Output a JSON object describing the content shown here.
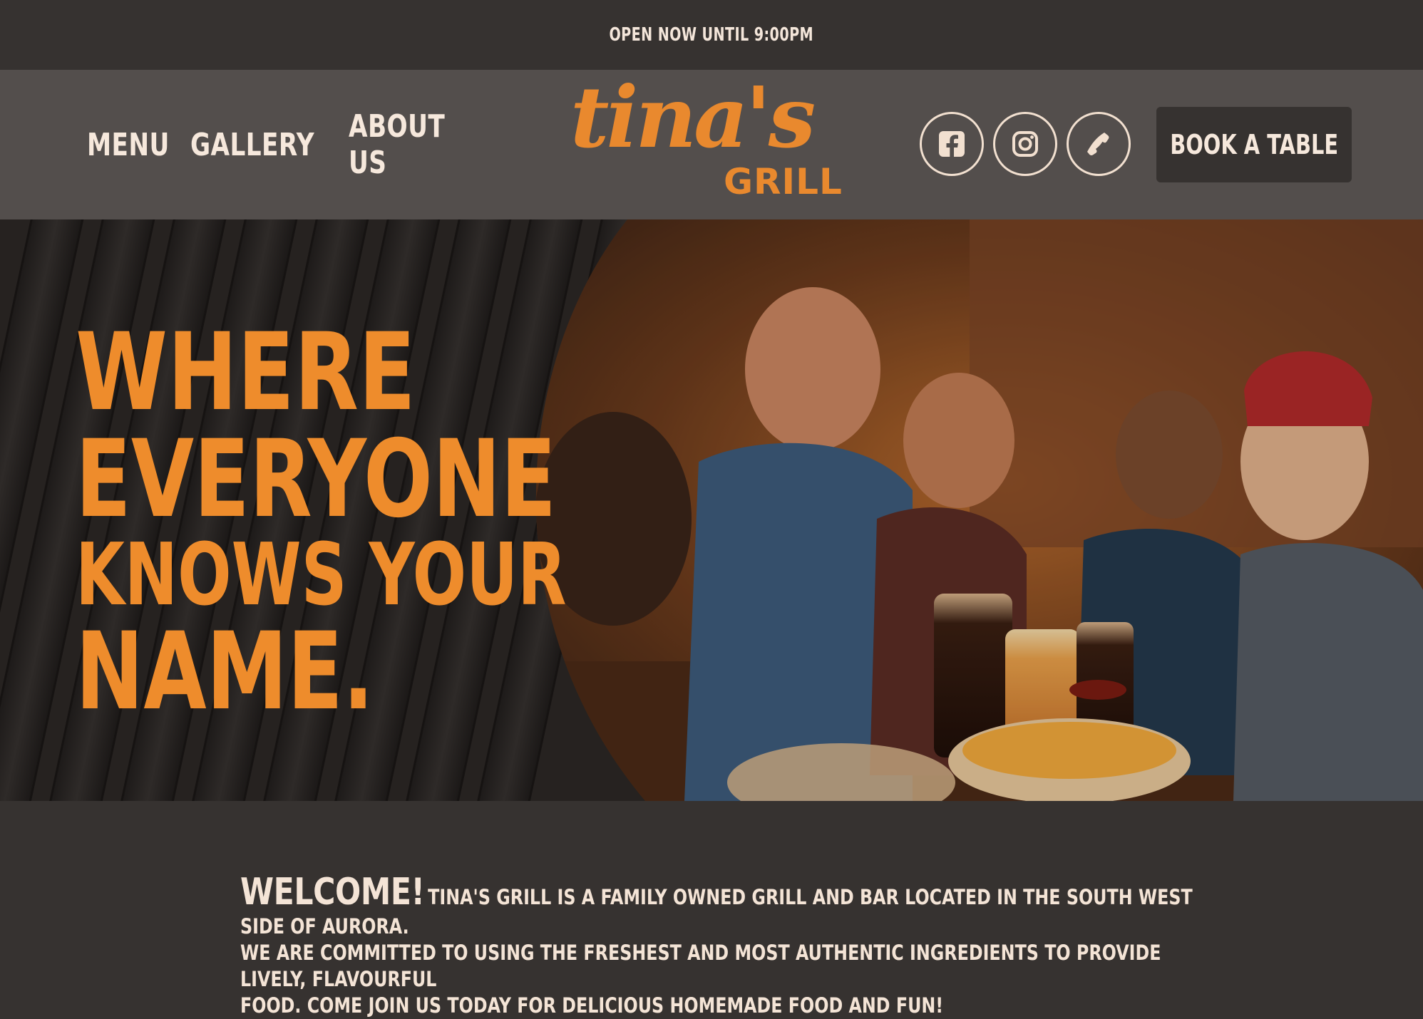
{
  "announcement": "OPEN NOW UNTIL 9:00PM",
  "nav": {
    "items": [
      "MENU",
      "GALLERY",
      "ABOUT US"
    ]
  },
  "logo": {
    "script": "tina's",
    "sub": "GRILL"
  },
  "social": [
    {
      "name": "facebook",
      "icon": "facebook-icon"
    },
    {
      "name": "instagram",
      "icon": "instagram-icon"
    },
    {
      "name": "phone",
      "icon": "phone-icon"
    }
  ],
  "cta": {
    "label": "BOOK A TABLE"
  },
  "hero": {
    "headline": [
      "WHERE",
      "EVERYONE",
      "KNOWS YOUR",
      "NAME."
    ],
    "image_alt": "Friends toasting with beer at a bar table"
  },
  "welcome": {
    "title": "WELCOME!",
    "body_first": "TINA'S GRILL IS A FAMILY OWNED GRILL AND BAR LOCATED IN THE SOUTH WEST SIDE OF AURORA.",
    "body_second": "WE ARE COMMITTED TO USING THE FRESHEST AND MOST AUTHENTIC  INGREDIENTS TO PROVIDE LIVELY, FLAVOURFUL",
    "body_third": "FOOD.  COME JOIN US TODAY FOR DELICIOUS HOMEMADE FOOD AND FUN!"
  },
  "colors": {
    "accent": "#e9892e",
    "topbar": "#363230",
    "navbar": "#534e4c",
    "text": "#f4e6da"
  }
}
